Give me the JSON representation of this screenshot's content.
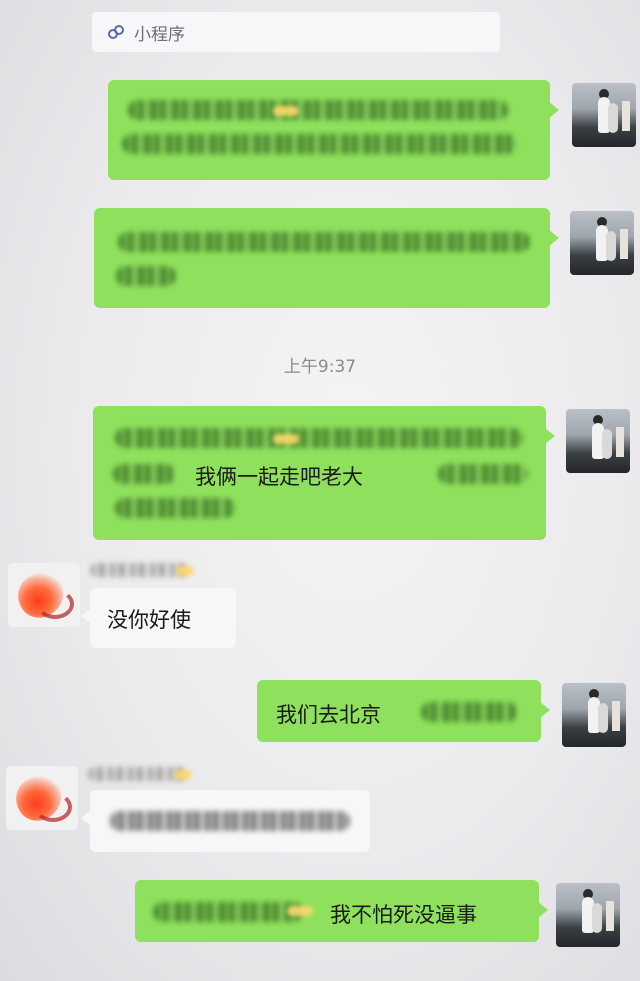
{
  "mini_program": {
    "label": "小程序",
    "icon": "mini-program-icon"
  },
  "timestamp": "上午9:37",
  "messages": {
    "m3_text": "我俩一起走吧老大",
    "m4_text": "没你好使",
    "m5_text": "我们去北京",
    "m7_text": "我不怕死没逼事"
  },
  "colors": {
    "self_bubble": "#8fe05c",
    "other_bubble": "#f7f7f8",
    "background": "#ededef",
    "timestamp": "#8a8a8a"
  }
}
